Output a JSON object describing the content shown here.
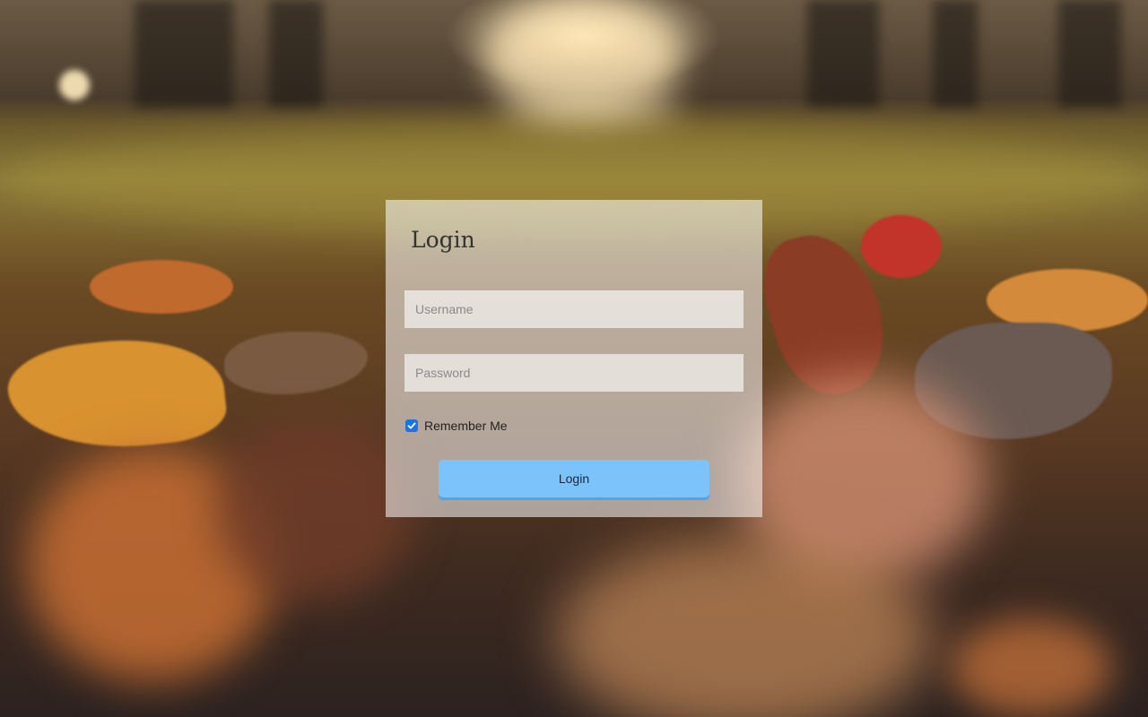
{
  "background": {
    "description_icon": "autumn-leaves-background"
  },
  "login": {
    "title": "Login",
    "username_placeholder": "Username",
    "username_value": "",
    "password_placeholder": "Password",
    "password_value": "",
    "remember_label": "Remember Me",
    "remember_checked": true,
    "button_label": "Login"
  },
  "colors": {
    "panel": "#ffffff",
    "button": "#7cc3fb",
    "checkbox": "#1a74e8"
  }
}
